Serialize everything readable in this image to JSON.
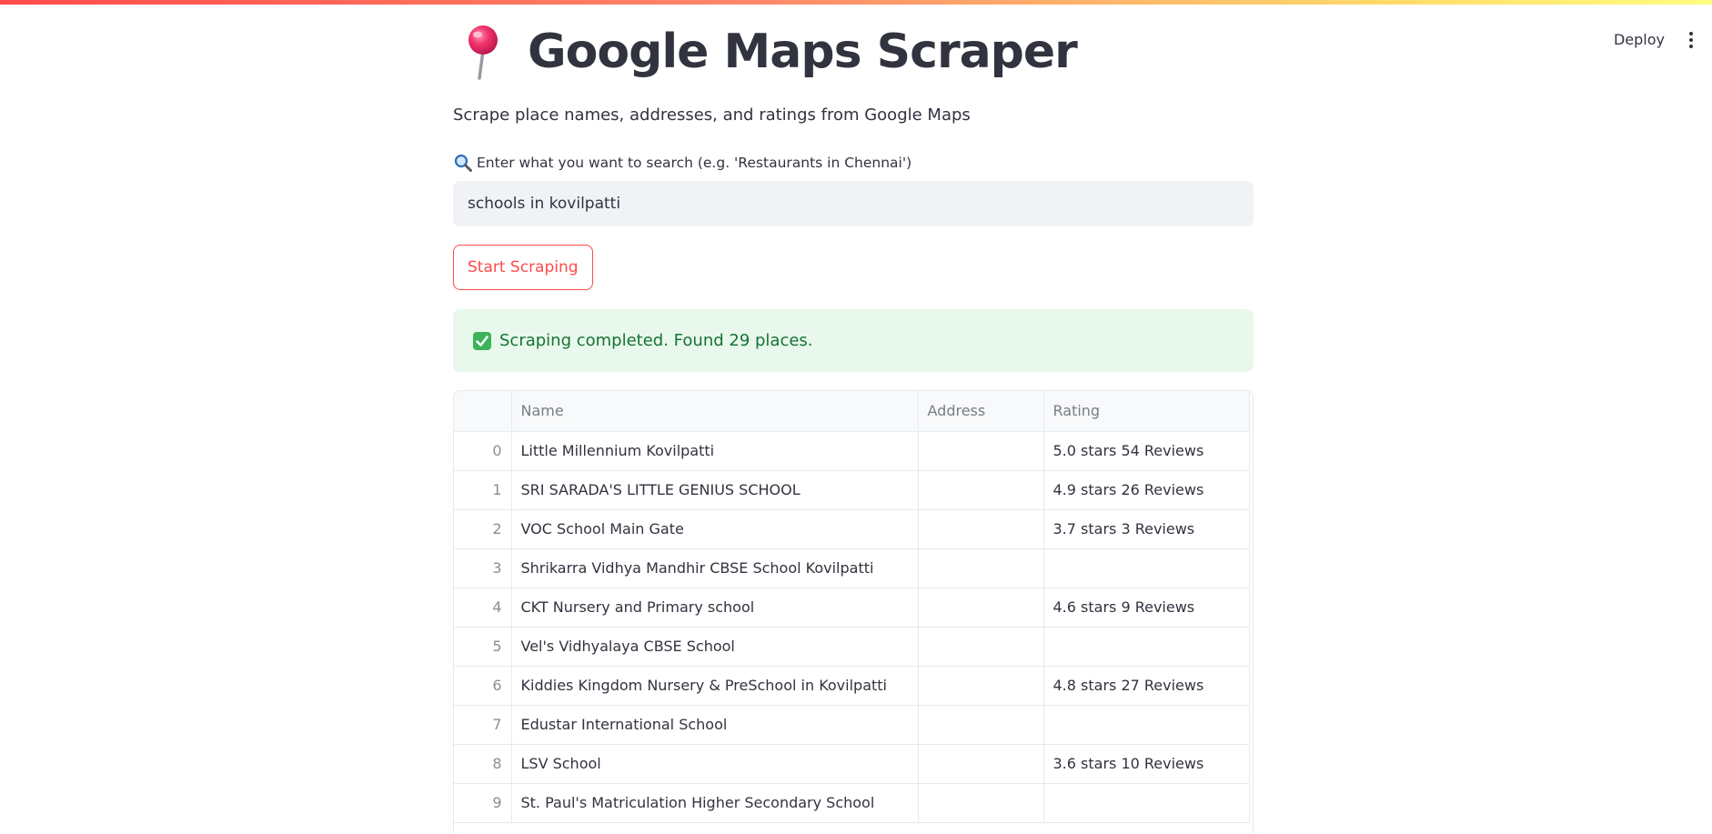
{
  "header": {
    "deploy_label": "Deploy",
    "menu_icon": "kebab-menu-icon"
  },
  "title": {
    "icon": "pushpin-icon",
    "text": "Google Maps Scraper"
  },
  "subtitle": "Scrape place names, addresses, and ratings from Google Maps",
  "search": {
    "icon": "magnifying-glass-icon",
    "label": "Enter what you want to search (e.g. 'Restaurants in Chennai')",
    "value": "schools in kovilpatti"
  },
  "start_button_label": "Start Scraping",
  "status": {
    "icon": "check-mark-icon",
    "message": "Scraping completed. Found 29 places.",
    "color": "#177233",
    "background": "#e8f8ec"
  },
  "table": {
    "columns": [
      "",
      "Name",
      "Address",
      "Rating"
    ],
    "rows": [
      {
        "index": "0",
        "name": "Little Millennium Kovilpatti",
        "address": "",
        "rating": "5.0 stars 54 Reviews"
      },
      {
        "index": "1",
        "name": "SRI SARADA'S LITTLE GENIUS SCHOOL",
        "address": "",
        "rating": "4.9 stars 26 Reviews"
      },
      {
        "index": "2",
        "name": "VOC School Main Gate",
        "address": "",
        "rating": "3.7 stars 3 Reviews"
      },
      {
        "index": "3",
        "name": "Shrikarra Vidhya Mandhir CBSE School Kovilpatti",
        "address": "",
        "rating": ""
      },
      {
        "index": "4",
        "name": "CKT Nursery and Primary school",
        "address": "",
        "rating": "4.6 stars 9 Reviews"
      },
      {
        "index": "5",
        "name": "Vel's Vidhyalaya CBSE School",
        "address": "",
        "rating": ""
      },
      {
        "index": "6",
        "name": "Kiddies Kingdom Nursery & PreSchool in Kovilpatti",
        "address": "",
        "rating": "4.8 stars 27 Reviews"
      },
      {
        "index": "7",
        "name": "Edustar International School",
        "address": "",
        "rating": ""
      },
      {
        "index": "8",
        "name": "LSV School",
        "address": "",
        "rating": "3.6 stars 10 Reviews"
      },
      {
        "index": "9",
        "name": "St. Paul's Matriculation Higher Secondary School",
        "address": "",
        "rating": ""
      }
    ]
  },
  "colors": {
    "accent": "#ff4b4b",
    "text": "#31333f",
    "input_bg": "#f0f2f6"
  }
}
